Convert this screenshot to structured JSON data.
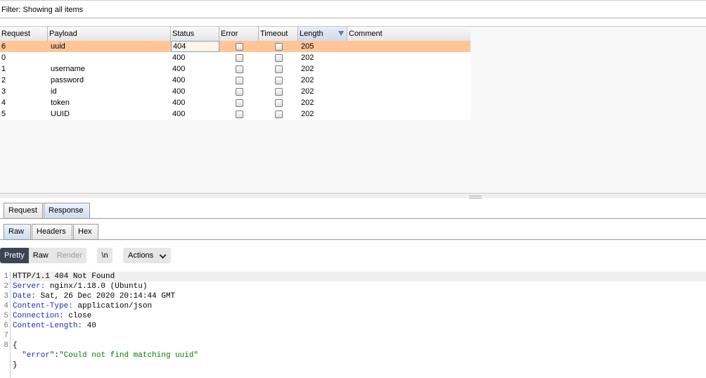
{
  "filter": {
    "text": "Filter: Showing all items"
  },
  "table": {
    "columns": [
      "Request",
      "Payload",
      "Status",
      "Error",
      "Timeout",
      "Length",
      "Comment"
    ],
    "rows": [
      {
        "request": "6",
        "payload": "uuid",
        "status": "404",
        "error": false,
        "timeout": false,
        "length": "205",
        "comment": ""
      },
      {
        "request": "0",
        "payload": "",
        "status": "400",
        "error": false,
        "timeout": false,
        "length": "202",
        "comment": ""
      },
      {
        "request": "1",
        "payload": "username",
        "status": "400",
        "error": false,
        "timeout": false,
        "length": "202",
        "comment": ""
      },
      {
        "request": "2",
        "payload": "password",
        "status": "400",
        "error": false,
        "timeout": false,
        "length": "202",
        "comment": ""
      },
      {
        "request": "3",
        "payload": "id",
        "status": "400",
        "error": false,
        "timeout": false,
        "length": "202",
        "comment": ""
      },
      {
        "request": "4",
        "payload": "token",
        "status": "400",
        "error": false,
        "timeout": false,
        "length": "202",
        "comment": ""
      },
      {
        "request": "5",
        "payload": "UUID",
        "status": "400",
        "error": false,
        "timeout": false,
        "length": "202",
        "comment": ""
      }
    ],
    "sort_icon": "sort-descending-icon"
  },
  "tabs_top": [
    "Request",
    "Response"
  ],
  "tabs_sub": [
    "Raw",
    "Headers",
    "Hex"
  ],
  "view_modes": [
    "Pretty",
    "Raw",
    "Render"
  ],
  "newline_label": "\\n",
  "actions_label": "Actions",
  "editor": {
    "line_numbers": [
      "1",
      "2",
      "3",
      "4",
      "5",
      "6",
      "7",
      "8"
    ],
    "lines": [
      {
        "key": "",
        "val": "HTTP/1.1 404 Not Found"
      },
      {
        "key": "Server:",
        "val": " nginx/1.18.0 (Ubuntu)"
      },
      {
        "key": "Date:",
        "val": " Sat, 26 Dec 2020 20:14:44 GMT"
      },
      {
        "key": "Content-Type:",
        "val": " application/json"
      },
      {
        "key": "Connection:",
        "val": " close"
      },
      {
        "key": "Content-Length:",
        "val": " 40"
      }
    ],
    "brace_open": "{",
    "json_key": "\"error\"",
    "json_colon": ":",
    "json_value": "\"Could not find matching uuid\"",
    "brace_close": "}"
  },
  "colors": {
    "selected_row": "#ffc597",
    "active_segment": "#3d4453",
    "json_string": "#008000"
  }
}
